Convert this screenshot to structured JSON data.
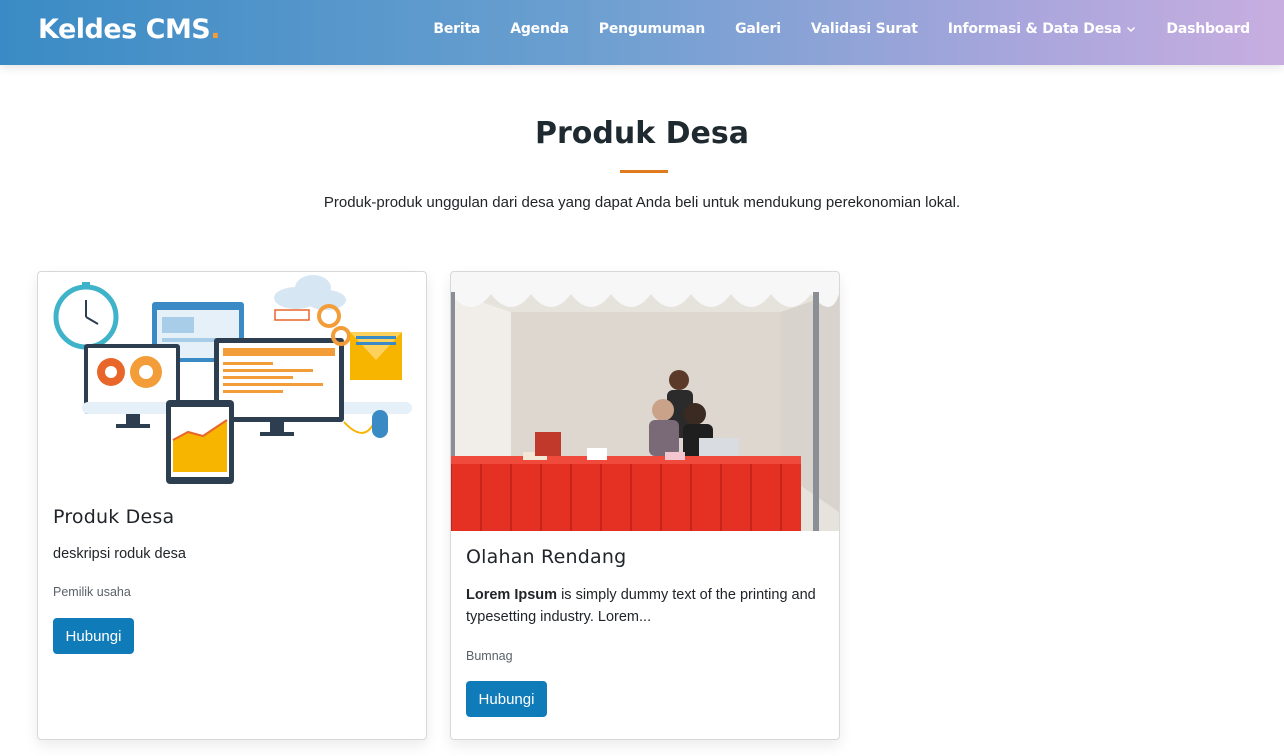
{
  "header": {
    "logo_text": "Keldes CMS",
    "logo_dot": ".",
    "nav": [
      {
        "label": "Berita"
      },
      {
        "label": "Agenda"
      },
      {
        "label": "Pengumuman"
      },
      {
        "label": "Galeri"
      },
      {
        "label": "Validasi Surat"
      },
      {
        "label": "Informasi & Data Desa",
        "has_dropdown": true
      },
      {
        "label": "Dashboard"
      }
    ]
  },
  "section": {
    "title": "Produk Desa",
    "subtitle": "Produk-produk unggulan dari desa yang dapat Anda beli untuk mendukung perekonomian lokal."
  },
  "products": [
    {
      "title": "Produk Desa",
      "description": "deskripsi roduk desa",
      "owner": "Pemilik usaha",
      "button_label": "Hubungi",
      "image_icon": "tech-devices-illustration"
    },
    {
      "title": "Olahan Rendang",
      "description_bold": "Lorem Ipsum",
      "description_rest": " is simply dummy text of the printing and typesetting industry. Lorem...",
      "owner": "Bumnag",
      "button_label": "Hubungi",
      "image_icon": "market-tent-photo"
    }
  ],
  "colors": {
    "accent": "#e07a1f",
    "button": "#0f7bb8",
    "header_start": "#3a8bc5",
    "header_end": "#c8aee0"
  }
}
